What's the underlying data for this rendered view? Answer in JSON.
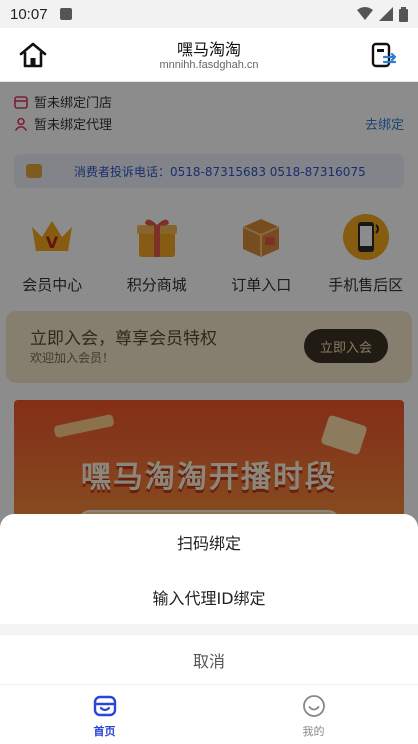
{
  "status_bar": {
    "time": "10:07"
  },
  "header": {
    "title": "嘿马淘淘",
    "subtitle": "mnnihh.fasdghah.cn"
  },
  "binding": {
    "store_text": "暂未绑定门店",
    "agent_text": "暂未绑定代理",
    "go_bind_label": "去绑定"
  },
  "complaint": {
    "text": "消费者投诉电话：0518-87315683 0518-87316075"
  },
  "menu": {
    "items": [
      {
        "label": "会员中心",
        "icon": "crown-v-icon"
      },
      {
        "label": "积分商城",
        "icon": "gift-box-icon"
      },
      {
        "label": "订单入口",
        "icon": "package-icon"
      },
      {
        "label": "手机售后区",
        "icon": "phone-icon"
      }
    ]
  },
  "member_card": {
    "title": "立即入会，尊享会员特权",
    "subtitle": "欢迎加入会员！",
    "button_label": "立即入会"
  },
  "banner": {
    "text": "嘿马淘淘开播时段"
  },
  "action_sheet": {
    "option1": "扫码绑定",
    "option2": "输入代理ID绑定",
    "cancel": "取消"
  },
  "tabbar": {
    "tabs": [
      {
        "label": "首页",
        "icon": "home-icon",
        "active": true
      },
      {
        "label": "我的",
        "icon": "smile-icon",
        "active": false
      }
    ]
  },
  "colors": {
    "accent": "#2a45d8",
    "link": "#2e7fd1",
    "complaint_text": "#2f54c7",
    "banner": "#f0552c"
  }
}
